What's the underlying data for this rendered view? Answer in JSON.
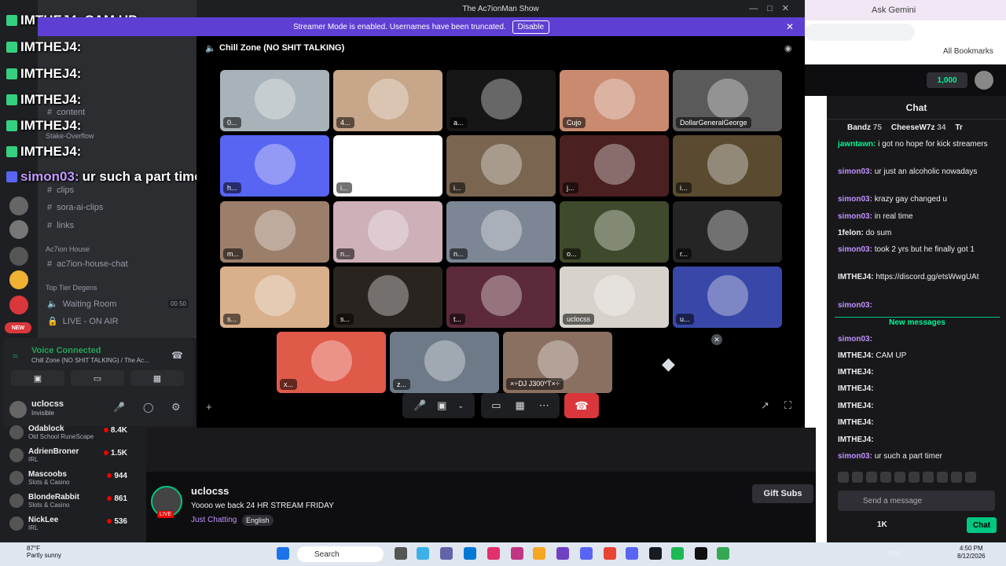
{
  "window": {
    "title": "The Ac7ionMan Show"
  },
  "banner": {
    "text": "Streamer Mode is enabled. Usernames have been truncated.",
    "disable": "Disable"
  },
  "voice_channel": {
    "name": "Chill Zone (NO SHIT TALKING)"
  },
  "overlay_chat": [
    {
      "name": "IMTHEJ4:",
      "text": "CAM UP"
    },
    {
      "name": "IMTHEJ4:",
      "text": ""
    },
    {
      "name": "IMTHEJ4:",
      "text": ""
    },
    {
      "name": "IMTHEJ4:",
      "text": ""
    },
    {
      "name": "IMTHEJ4:",
      "text": ""
    },
    {
      "name": "IMTHEJ4:",
      "text": ""
    },
    {
      "name": "simon03:",
      "text": "ur such a part timer"
    }
  ],
  "server": {
    "name": "The Ac7ionMan Show"
  },
  "channels": [
    {
      "label": "content"
    },
    {
      "label": "clips"
    },
    {
      "label": "sora-ai-clips"
    },
    {
      "label": "links"
    },
    {
      "label": "ac7ion-house-chat"
    },
    {
      "label": "Waiting Room",
      "count_a": "00",
      "count_b": "50"
    },
    {
      "label": "LIVE - ON AIR"
    }
  ],
  "categories": [
    "Stake-Overflow",
    "Ac7ion House",
    "Top Tier Degens"
  ],
  "voice": {
    "status": "Voice Connected",
    "channel": "Chill Zone (NO SHIT TALKING) / The Ac..."
  },
  "user": {
    "name": "uclocss",
    "status": "Invisible"
  },
  "participants": [
    {
      "label": "0...",
      "bg": "#a7b3b8"
    },
    {
      "label": "4...",
      "bg": "#c7a689"
    },
    {
      "label": "a...",
      "bg": "#161616"
    },
    {
      "label": "Cujo",
      "bg": "#c98a70"
    },
    {
      "label": "DollarGeneralGeorge",
      "bg": "#5a5a5a"
    },
    {
      "label": "h...",
      "bg": "#5865f2"
    },
    {
      "label": "i...",
      "bg": "#ffffff"
    },
    {
      "label": "i...",
      "bg": "#7a6650"
    },
    {
      "label": "j...",
      "bg": "#4a2020"
    },
    {
      "label": "i...",
      "bg": "#5a4a30"
    },
    {
      "label": "m...",
      "bg": "#9c7f6b"
    },
    {
      "label": "n...",
      "bg": "#cdb0b8"
    },
    {
      "label": "n...",
      "bg": "#7d8694"
    },
    {
      "label": "o...",
      "bg": "#3f4a2c"
    },
    {
      "label": "r...",
      "bg": "#252525"
    },
    {
      "label": "s...",
      "bg": "#d9b08c"
    },
    {
      "label": "s...",
      "bg": "#2a2420"
    },
    {
      "label": "t...",
      "bg": "#5c2a3a"
    },
    {
      "label": "uclocss",
      "bg": "#d7d3cc"
    },
    {
      "label": "u...",
      "bg": "#3847a8"
    },
    {
      "label": "x...",
      "bg": "#e05a4a"
    },
    {
      "label": "z...",
      "bg": "#6e7a88"
    },
    {
      "label": "×÷DJ J300ⱽT×÷",
      "bg": "#8a7060"
    }
  ],
  "twitch_chat": {
    "title": "Chat",
    "top_chatters": [
      {
        "name": "Bandz",
        "count": "75"
      },
      {
        "name": "CheeseW7z",
        "count": "34"
      },
      {
        "name": "Tr",
        "count": ""
      }
    ],
    "messages": [
      {
        "name": "jawntawn:",
        "text": "i got no hope for kick streamers",
        "color": "#00f593"
      },
      {
        "name": "simon03:",
        "text": "ur just an alcoholic nowadays",
        "color": "#bf94ff"
      },
      {
        "name": "simon03:",
        "text": "krazy gay changed u",
        "color": "#bf94ff"
      },
      {
        "name": "simon03:",
        "text": "in real time",
        "color": "#bf94ff"
      },
      {
        "name": "1felon:",
        "text": "do sum",
        "color": "#efeff1"
      },
      {
        "name": "simon03:",
        "text": "took 2 yrs but he finally got 1",
        "color": "#bf94ff"
      },
      {
        "name": "IMTHEJ4:",
        "text": "https://discord.gg/etsWwgUAt",
        "color": "#efeff1"
      },
      {
        "name": "simon03:",
        "text": "",
        "color": "#bf94ff"
      }
    ],
    "new_messages": "New messages",
    "messages2": [
      {
        "name": "simon03:",
        "text": "",
        "color": "#bf94ff"
      },
      {
        "name": "IMTHEJ4:",
        "text": "CAM UP",
        "color": "#efeff1"
      },
      {
        "name": "IMTHEJ4:",
        "text": "",
        "color": "#efeff1"
      },
      {
        "name": "IMTHEJ4:",
        "text": "",
        "color": "#efeff1"
      },
      {
        "name": "IMTHEJ4:",
        "text": "",
        "color": "#efeff1"
      },
      {
        "name": "IMTHEJ4:",
        "text": "",
        "color": "#efeff1"
      },
      {
        "name": "IMTHEJ4:",
        "text": "",
        "color": "#efeff1"
      },
      {
        "name": "simon03:",
        "text": "ur such a part timer",
        "color": "#bf94ff"
      }
    ],
    "placeholder": "Send a message",
    "points": "1K",
    "chat_button": "Chat",
    "top_points": "1,000"
  },
  "following": [
    {
      "name": "Odablock",
      "game": "Old School RuneScape",
      "count": "8.4K"
    },
    {
      "name": "AdrienBroner",
      "game": "IRL",
      "count": "1.5K"
    },
    {
      "name": "Mascoobs",
      "game": "Slots & Casino",
      "count": "944"
    },
    {
      "name": "BlondeRabbit",
      "game": "Slots & Casino",
      "count": "861"
    },
    {
      "name": "NickLee",
      "game": "IRL",
      "count": "536"
    }
  ],
  "stream": {
    "name": "uclocss",
    "title": "Yoooo we back 24 HR STREAM FRIDAY",
    "category": "Just Chatting",
    "language": "English",
    "live": "LIVE",
    "gift": "Gift Subs"
  },
  "browser": {
    "gemini": "Ask Gemini",
    "bookmarks": "All Bookmarks"
  },
  "taskbar": {
    "weather_temp": "87°F",
    "weather_desc": "Partly sunny",
    "search": "Search",
    "time": "4:50 PM",
    "date": "8/12/2026",
    "lang": "ENG"
  }
}
